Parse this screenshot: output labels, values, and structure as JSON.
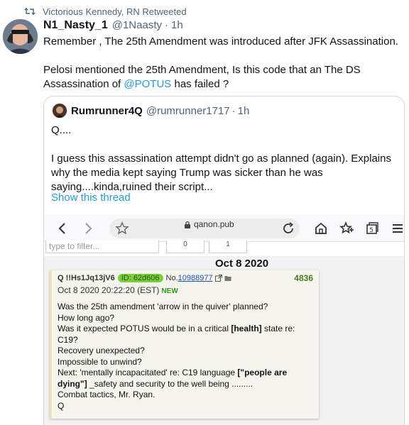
{
  "retweet": {
    "label": "Victorious Kennedy, RN Retweeted"
  },
  "tweet": {
    "name": "N1_Nasty_1",
    "handle": "@1Naasty",
    "separator": "·",
    "time": "1h",
    "line1": "Remember , The 25th Amendment was introduced after JFK Assassination.",
    "line2_before": "Pelosi mentioned the 25th Amendment, Is this code that an The DS Assassination of ",
    "mention": "@POTUS",
    "line2_after": " has failed  ?"
  },
  "quote": {
    "name": "Rumrunner4Q",
    "handle": "@rumrunner1717",
    "separator": "·",
    "time": "1h",
    "line1": "Q....",
    "line2": "I guess this assassination attempt didn't go as planned (again). Explains why the media kept saying Trump was sicker than he was saying....kinda,ruined their script...",
    "show_thread": "Show this thread"
  },
  "media": {
    "url": "qanon.pub",
    "filter_placeholder": "type to filter...",
    "filter_btn1": "0",
    "filter_btn2": "1",
    "date_heading": "Oct 8 2020",
    "post": {
      "trip": "Q !!Hs1Jq13jV6",
      "id_badge": "ID: 62d606",
      "no_label": "No.",
      "post_number": "10988977",
      "count": "4836",
      "date": "Oct 8 2020 20:22:20 (EST)",
      "new_label": "NEW",
      "l1": "Was the 25th amendment 'arrow in the quiver' planned?",
      "l2": "How long ago?",
      "l3_a": "Was it expected POTUS would be in a critical ",
      "l3_b": "[health]",
      "l3_c": " state re:",
      "l4": "C19?",
      "l5": "Recovery unexpected?",
      "l6": "Impossible to unwind?",
      "l7_a": "Next: 'mentally incapacitated' re: C19 language ",
      "l7_b": "[\"people are",
      "l8_a": "dying\"]",
      "l8_b": " _safety and security to the well being .........",
      "l9": "Combat tactics, Mr. Ryan.",
      "l10": "Q"
    }
  }
}
